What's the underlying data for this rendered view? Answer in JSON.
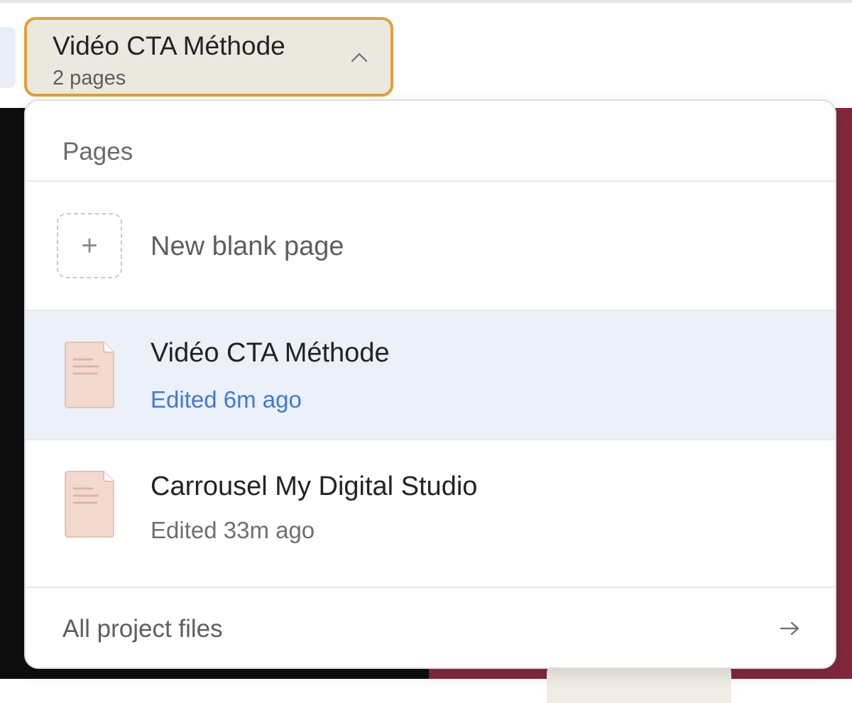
{
  "switcher": {
    "title": "Vidéo CTA Méthode",
    "page_count": "2 pages",
    "icon": "chevron-up-icon"
  },
  "dropdown": {
    "header": "Pages",
    "new_page": {
      "label": "New blank page",
      "icon": "plus-icon"
    },
    "pages": [
      {
        "title": "Vidéo CTA Méthode",
        "meta": "Edited 6m ago",
        "selected": true,
        "icon": "page-thumbnail-icon"
      },
      {
        "title": "Carrousel My Digital Studio",
        "meta": "Edited 33m ago",
        "selected": false,
        "icon": "page-thumbnail-icon"
      }
    ],
    "footer": {
      "label": "All project files",
      "icon": "arrow-right-icon"
    }
  },
  "colors": {
    "switcher_border": "#e0a13a",
    "switcher_bg": "#ebe8e0",
    "selected_row_bg": "#ebf0f9",
    "edited_link": "#3f7bd6",
    "slide_bg": "#82283c"
  }
}
